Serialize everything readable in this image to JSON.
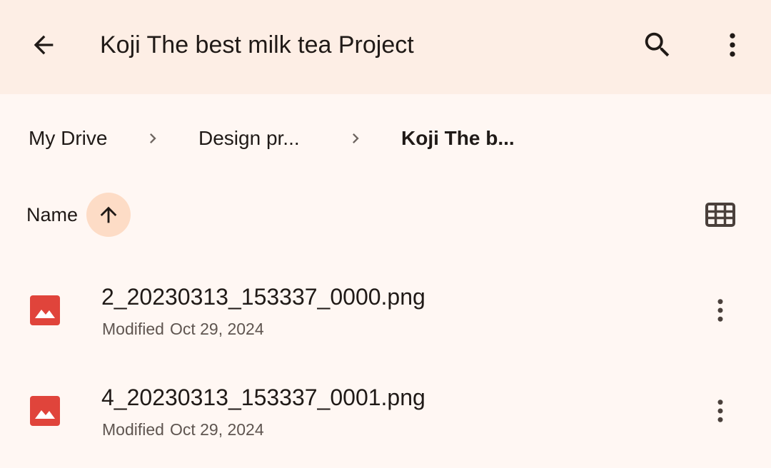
{
  "app_bar": {
    "title": "Koji The best milk tea Project",
    "back_icon": "arrow-back-icon",
    "search_icon": "search-icon",
    "more_icon": "more-vert-icon"
  },
  "breadcrumb": {
    "items": [
      {
        "label": "My Drive"
      },
      {
        "label": "Design pr..."
      },
      {
        "label": "Koji The b..."
      }
    ],
    "separator_icon": "chevron-right-icon"
  },
  "sort": {
    "label": "Name",
    "direction_icon": "arrow-upward-icon",
    "view_toggle_icon": "grid-view-icon"
  },
  "files": [
    {
      "name": "2_20230313_153337_0000.png",
      "modified_label": "Modified",
      "modified_date": "Oct 29, 2024",
      "type_icon": "image-file-icon"
    },
    {
      "name": "4_20230313_153337_0001.png",
      "modified_label": "Modified",
      "modified_date": "Oct 29, 2024",
      "type_icon": "image-file-icon"
    }
  ],
  "colors": {
    "app_bar_bg": "#fdeee5",
    "page_bg": "#fff7f3",
    "sort_button_bg": "#fddcc6",
    "image_icon": "#e0443b",
    "text_primary": "#201a17",
    "text_secondary": "#5f5550"
  }
}
